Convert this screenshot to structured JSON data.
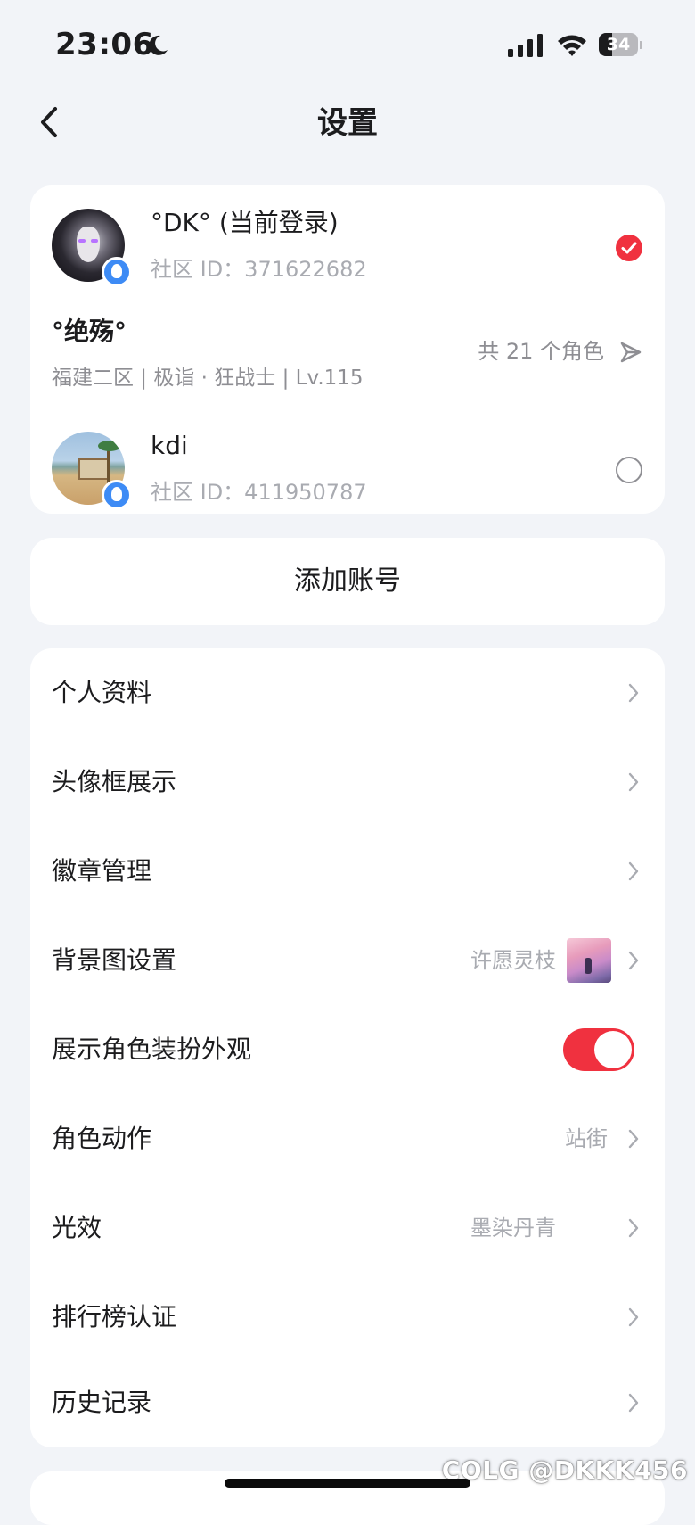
{
  "status_bar": {
    "time": "23:06",
    "battery": "34",
    "battery_level": 0.34
  },
  "nav": {
    "title": "设置"
  },
  "accounts": {
    "current": {
      "name": "°DK° (当前登录)",
      "id_text": "社区 ID：371622682",
      "selected": true
    },
    "role": {
      "name": "°绝殇°",
      "detail": "福建二区 | 极诣 · 狂战士 | Lv.115",
      "count_text": "共 21 个角色"
    },
    "other": {
      "name": "kdi",
      "id_text": "社区 ID：411950787",
      "selected": false
    }
  },
  "add_account": {
    "label": "添加账号"
  },
  "menu": {
    "items": [
      {
        "label": "个人资料",
        "value": ""
      },
      {
        "label": "头像框展示",
        "value": ""
      },
      {
        "label": "徽章管理",
        "value": ""
      },
      {
        "label": "背景图设置",
        "value": "许愿灵枝"
      },
      {
        "label": "展示角色装扮外观",
        "value": "",
        "toggle_on": true
      },
      {
        "label": "角色动作",
        "value": "站街"
      },
      {
        "label": "光效",
        "value": "墨染丹青"
      },
      {
        "label": "排行榜认证",
        "value": ""
      },
      {
        "label": "历史记录",
        "value": ""
      }
    ]
  },
  "watermark": "COLG @DKKK456",
  "colors": {
    "accent": "#f0313f",
    "background": "#f2f4f8",
    "card": "#ffffff",
    "qq_blue": "#3d8bf5"
  },
  "icons": [
    "back-icon",
    "moon-icon",
    "signal-icon",
    "wifi-icon",
    "battery-icon",
    "qq-icon",
    "check-icon",
    "switch-role-icon",
    "chevron-right-icon"
  ]
}
